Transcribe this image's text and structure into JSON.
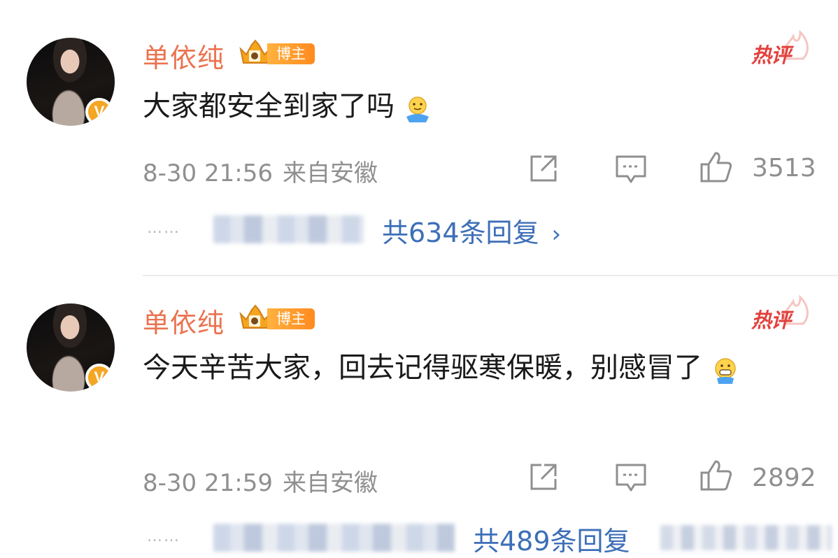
{
  "comments": [
    {
      "username": "单依纯",
      "badge_label": "博主",
      "hot_label": "热评",
      "text": "大家都安全到家了吗",
      "emoji": "hug-emoji",
      "time": "8-30 21:56",
      "location": "来自安徽",
      "likes": "3513",
      "replies_dots": "……",
      "replies_label": "共634条回复",
      "chevron": "›"
    },
    {
      "username": "单依纯",
      "badge_label": "博主",
      "hot_label": "热评",
      "text": "今天辛苦大家，回去记得驱寒保暖，别感冒了",
      "emoji": "grin-emoji",
      "time": "8-30 21:59",
      "location": "来自安徽",
      "likes": "2892",
      "replies_dots": "……",
      "replies_label": "共489条回复"
    }
  ],
  "colors": {
    "username": "#eb7350",
    "hot": "#e2413d",
    "link": "#3d6fb8",
    "meta": "#8f8f8f",
    "verified": "#f5a623"
  }
}
